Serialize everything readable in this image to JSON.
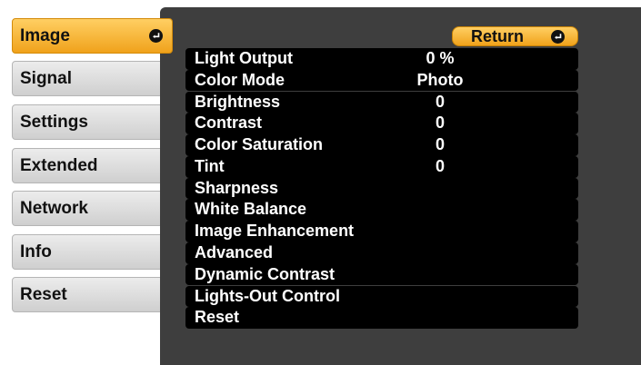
{
  "tabs": [
    {
      "label": "Image",
      "active": true
    },
    {
      "label": "Signal",
      "active": false
    },
    {
      "label": "Settings",
      "active": false
    },
    {
      "label": "Extended",
      "active": false
    },
    {
      "label": "Network",
      "active": false
    },
    {
      "label": "Info",
      "active": false
    },
    {
      "label": "Reset",
      "active": false
    }
  ],
  "return_button": {
    "label": "Return"
  },
  "menu": [
    {
      "label": "Light Output",
      "value": "0 %"
    },
    {
      "label": "Color Mode",
      "value": "Photo"
    },
    {
      "label": "Brightness",
      "value": "0"
    },
    {
      "label": "Contrast",
      "value": "0"
    },
    {
      "label": "Color Saturation",
      "value": "0"
    },
    {
      "label": "Tint",
      "value": "0"
    },
    {
      "label": "Sharpness",
      "value": ""
    },
    {
      "label": "White Balance",
      "value": ""
    },
    {
      "label": "Image Enhancement",
      "value": ""
    },
    {
      "label": "Advanced",
      "value": ""
    },
    {
      "label": "Dynamic Contrast",
      "value": ""
    },
    {
      "label": "Lights-Out Control",
      "value": ""
    },
    {
      "label": "Reset",
      "value": ""
    }
  ],
  "colors": {
    "accent": "#f0a21b",
    "panel": "#3e3e3e",
    "row": "#000000",
    "tab": "#dcdcdc"
  },
  "icons": {
    "enter": "enter-icon"
  }
}
